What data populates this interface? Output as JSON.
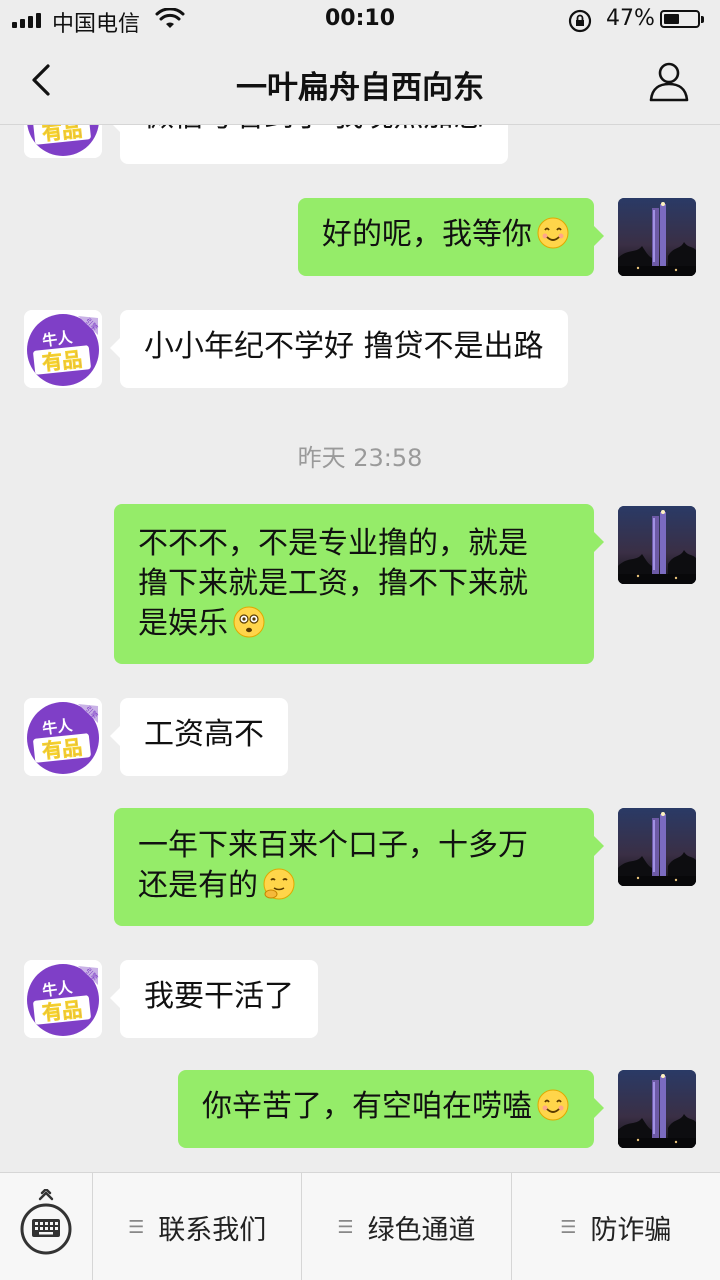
{
  "status_bar": {
    "carrier": "中国电信",
    "time": "00:10",
    "battery_percent": "47%",
    "battery_level": 0.47
  },
  "nav": {
    "title": "一叶扁舟自西向东",
    "back_icon": "chevron-left-icon",
    "profile_icon": "person-icon"
  },
  "avatar_logo": {
    "line1": "牛人",
    "line2": "有品",
    "tag": "引擎",
    "colors": {
      "ring": "#7f3fc7",
      "text": "#f6d22b"
    }
  },
  "messages": [
    {
      "side": "left",
      "text": "微信号看到了  我晚点加您"
    },
    {
      "side": "right",
      "text": "好的呢，我等你",
      "emoji": "smile-emoji"
    },
    {
      "side": "left",
      "text": "小小年纪不学好  撸贷不是出路"
    },
    {
      "type": "timestamp",
      "text": "昨天 23:58"
    },
    {
      "side": "right",
      "lines": [
        "不不不，不是专业撸的，就是",
        "撸下来就是工资，撸不下来就",
        "是娱乐"
      ],
      "emoji": "flushed-emoji"
    },
    {
      "side": "left",
      "text": "工资高不"
    },
    {
      "side": "right",
      "lines": [
        "一年下来百来个口子，十多万",
        "还是有的"
      ],
      "emoji": "shy-emoji"
    },
    {
      "side": "left",
      "text": "我要干活了"
    },
    {
      "side": "right",
      "text": "你辛苦了，有空咱在唠嗑",
      "emoji": "smile-emoji"
    }
  ],
  "bottom_menu": {
    "keyboard_icon": "keyboard-icon",
    "items": [
      "联系我们",
      "绿色通道",
      "防诈骗"
    ]
  },
  "colors": {
    "background": "#ededed",
    "bubble_right": "#95ec69",
    "bubble_left": "#ffffff"
  }
}
